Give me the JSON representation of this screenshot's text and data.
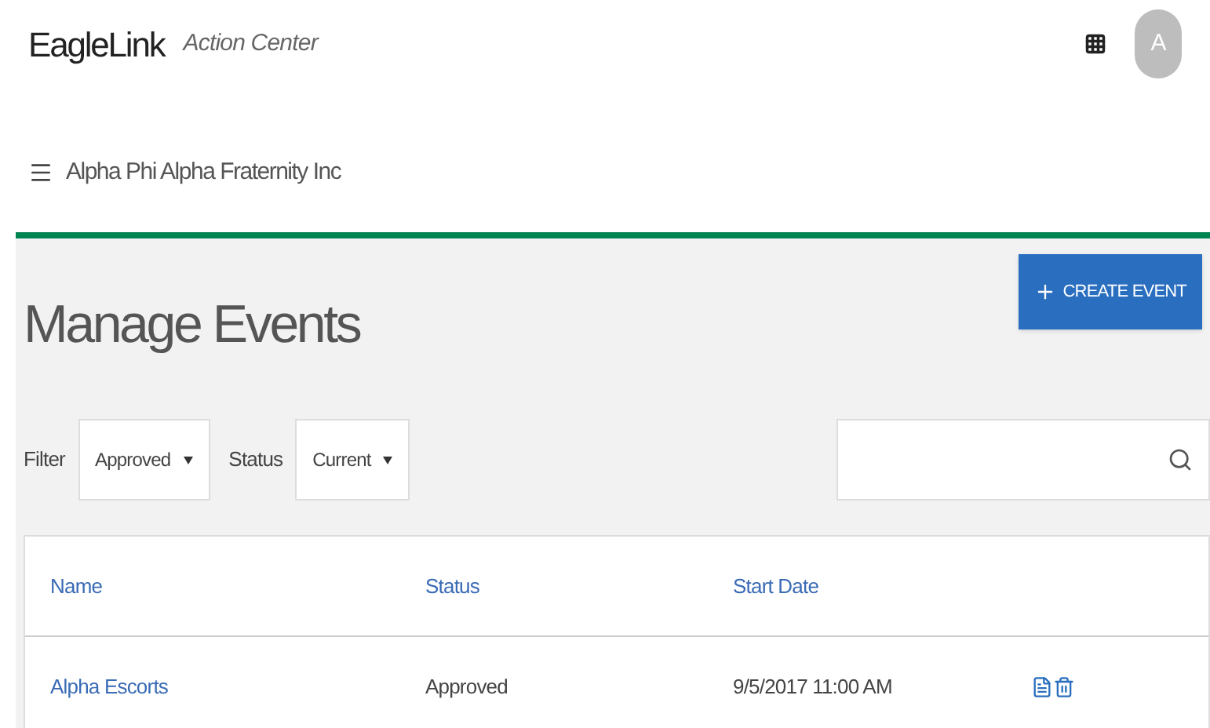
{
  "header": {
    "brand": "EagleLink",
    "subtitle": "Action Center",
    "avatar": "A"
  },
  "org": {
    "name": "Alpha Phi Alpha Fraternity Inc"
  },
  "page": {
    "title": "Manage Events",
    "create_button": "CREATE EVENT"
  },
  "filters": [
    {
      "label": "Filter",
      "value": "Approved"
    },
    {
      "label": "Status",
      "value": "Current"
    }
  ],
  "table": {
    "columns": [
      "Name",
      "Status",
      "Start Date"
    ],
    "rows": [
      {
        "name": "Alpha Escorts",
        "status": "Approved",
        "start_date": "9/5/2017 11:00 AM"
      }
    ]
  }
}
